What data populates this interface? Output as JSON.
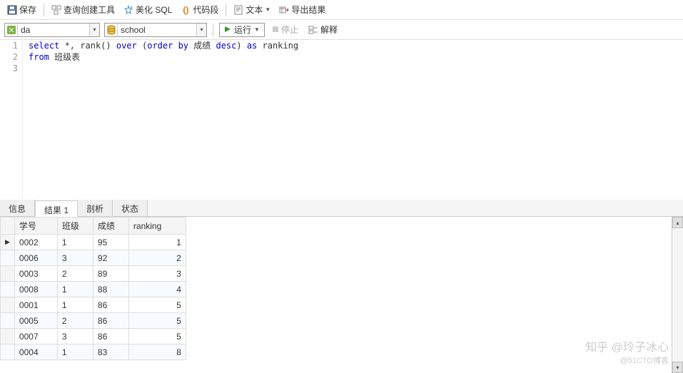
{
  "toolbar": {
    "save": "保存",
    "query_builder": "查询创建工具",
    "beautify_sql": "美化 SQL",
    "code_snippet": "代码段",
    "text": "文本",
    "export_result": "导出结果"
  },
  "dropdowns": {
    "connection": "da",
    "database": "school"
  },
  "actions": {
    "run": "运行",
    "stop": "停止",
    "explain": "解释"
  },
  "editor": {
    "lines": [
      "1",
      "2",
      "3"
    ],
    "line1_tokens": {
      "select": "select",
      "star": " *, ",
      "rank": "rank",
      "open": "() ",
      "over": "over",
      "p1": " (",
      "orderby": "order by",
      "col": " 成绩 ",
      "desc": "desc",
      "p2": ") ",
      "as": "as",
      "alias": " ranking"
    },
    "line2_tokens": {
      "from": "from",
      "table": " 班级表"
    }
  },
  "tabs": {
    "info": "信息",
    "result": "结果 1",
    "profile": "剖析",
    "status": "状态"
  },
  "grid": {
    "headers": [
      "学号",
      "班级",
      "成绩",
      "ranking"
    ],
    "rows": [
      {
        "c0": "0002",
        "c1": "1",
        "c2": "95",
        "c3": "1"
      },
      {
        "c0": "0006",
        "c1": "3",
        "c2": "92",
        "c3": "2"
      },
      {
        "c0": "0003",
        "c1": "2",
        "c2": "89",
        "c3": "3"
      },
      {
        "c0": "0008",
        "c1": "1",
        "c2": "88",
        "c3": "4"
      },
      {
        "c0": "0001",
        "c1": "1",
        "c2": "86",
        "c3": "5"
      },
      {
        "c0": "0005",
        "c1": "2",
        "c2": "86",
        "c3": "5"
      },
      {
        "c0": "0007",
        "c1": "3",
        "c2": "86",
        "c3": "5"
      },
      {
        "c0": "0004",
        "c1": "1",
        "c2": "83",
        "c3": "8"
      }
    ]
  },
  "watermark": {
    "main": "知乎 @玲子冰心",
    "sub": "@51CTO博客"
  }
}
